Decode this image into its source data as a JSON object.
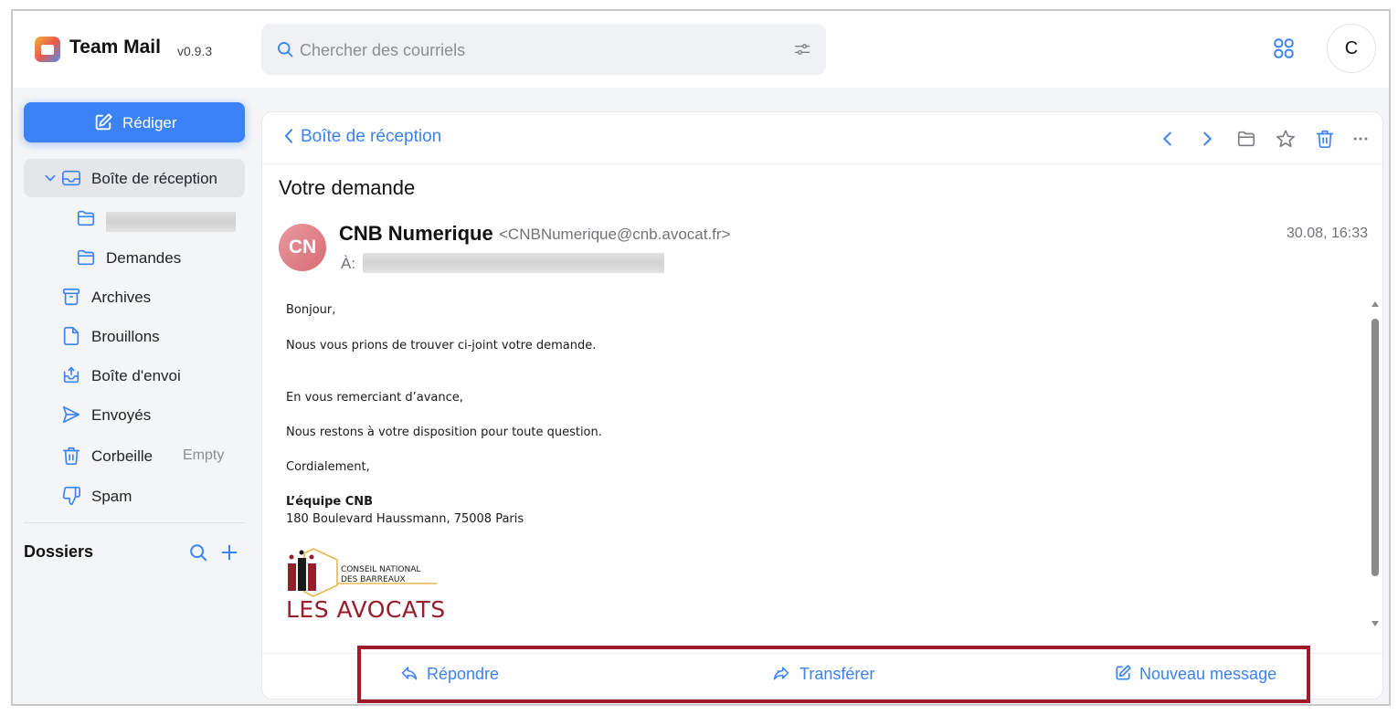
{
  "app": {
    "title": "Team Mail",
    "version": "v0.9.3"
  },
  "search": {
    "placeholder": "Chercher des courriels",
    "icon": "search-icon",
    "filter_icon": "sliders-icon"
  },
  "user": {
    "initial": "C"
  },
  "sidebar": {
    "compose_label": "Rédiger",
    "items": [
      {
        "label": "Boîte de réception",
        "icon": "inbox-icon",
        "expanded": true
      },
      {
        "label": "",
        "icon": "folder-icon",
        "redacted": true
      },
      {
        "label": "Demandes",
        "icon": "folder-icon"
      },
      {
        "label": "Archives",
        "icon": "archive-icon"
      },
      {
        "label": "Brouillons",
        "icon": "draft-icon"
      },
      {
        "label": "Boîte d'envoi",
        "icon": "outbox-icon"
      },
      {
        "label": "Envoyés",
        "icon": "send-icon"
      },
      {
        "label": "Corbeille",
        "icon": "trash-icon",
        "action": "Empty"
      },
      {
        "label": "Spam",
        "icon": "thumbs-down-icon"
      }
    ],
    "folders_title": "Dossiers"
  },
  "message": {
    "back_label": "Boîte de réception",
    "subject": "Votre demande",
    "sender_initials": "CN",
    "sender_name": "CNB Numerique",
    "sender_email": "<CNBNumerique@cnb.avocat.fr>",
    "to_label": "À:",
    "date": "30.08, 16:33",
    "body": {
      "greeting": "Bonjour,",
      "line1": "Nous vous prions de trouver ci-joint votre demande.",
      "line2": "En vous remerciant d’avance,",
      "line3": "Nous restons à votre disposition pour toute question.",
      "closing": "Cordialement,",
      "signature_name": "L’équipe CNB",
      "signature_address": "180 Boulevard Haussmann, 75008 Paris"
    },
    "logo": {
      "line1": "CONSEIL NATIONAL",
      "line2": "DES BARREAUX",
      "line3": "LES AVOCATS"
    }
  },
  "actions": {
    "reply": "Répondre",
    "forward": "Transférer",
    "new_message": "Nouveau message"
  },
  "colors": {
    "accent": "#3b82f6",
    "highlight": "#a11a2b",
    "sender_avatar": "#d96b73"
  }
}
